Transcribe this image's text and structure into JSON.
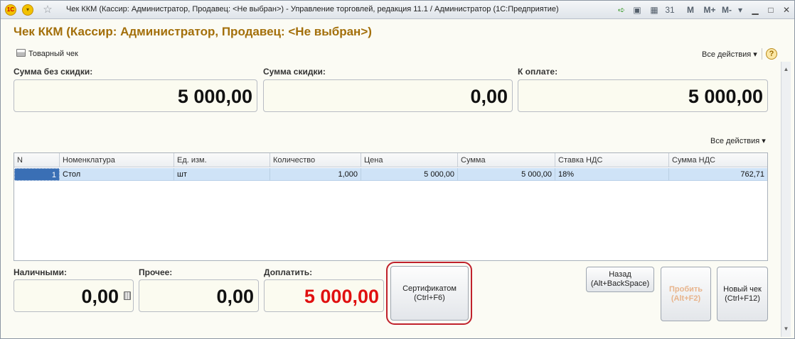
{
  "window": {
    "title": "Чек ККМ (Кассир: Администратор, Продавец: <Не выбран>) - Управление торговлей, редакция 11.1 / Администратор  (1С:Предприятие)",
    "logo": "1С",
    "toolbar_icons": [
      "navigate-forward-icon",
      "history-icon",
      "calculator-icon",
      "calendar-icon",
      "M",
      "M+",
      "M-",
      "dropdown-icon"
    ],
    "cal_label": "31",
    "mem_m": "M",
    "mem_mplus": "M+",
    "mem_mminus": "M-"
  },
  "form": {
    "title": "Чек ККМ (Кассир: Администратор, Продавец: <Не выбран>)",
    "print_button": "Товарный чек",
    "all_actions": "Все действия ▾",
    "help": "?"
  },
  "totals": {
    "sum_no_discount_label": "Сумма без скидки:",
    "sum_no_discount": "5 000,00",
    "discount_label": "Сумма скидки:",
    "discount": "0,00",
    "to_pay_label": "К оплате:",
    "to_pay": "5 000,00"
  },
  "table": {
    "all_actions": "Все действия ▾",
    "columns": [
      "N",
      "Номенклатура",
      "Ед. изм.",
      "Количество",
      "Цена",
      "Сумма",
      "Ставка НДС",
      "Сумма НДС"
    ],
    "rows": [
      {
        "n": "1",
        "item": "Стол",
        "unit": "шт",
        "qty": "1,000",
        "price": "5 000,00",
        "sum": "5 000,00",
        "vat_rate": "18%",
        "vat_sum": "762,71"
      }
    ]
  },
  "payment": {
    "cash_label": "Наличными:",
    "cash": "0,00",
    "other_label": "Прочее:",
    "other": "0,00",
    "surcharge_label": "Доплатить:",
    "surcharge": "5 000,00"
  },
  "buttons": {
    "certificate_line1": "Сертификатом",
    "certificate_line2": "(Ctrl+F6)",
    "back_line1": "Назад",
    "back_line2": "(Alt+BackSpace)",
    "print_line1": "Пробить",
    "print_line2": "(Alt+F2)",
    "new_line1": "Новый чек",
    "new_line2": "(Ctrl+F12)"
  },
  "colors": {
    "title": "#a36f0a",
    "surcharge": "#e01010",
    "selected_row": "#cfe3f7",
    "highlight_ring": "#c0212b"
  }
}
